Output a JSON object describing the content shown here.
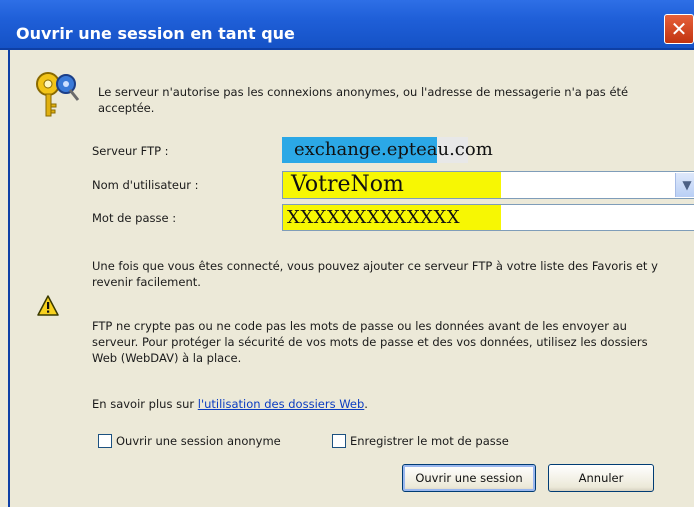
{
  "window": {
    "title": "Ouvrir une session en tant que",
    "close_glyph": "✕"
  },
  "message": "Le serveur n'autorise pas les connexions anonymes, ou l'adresse de messagerie n'a pas été acceptée.",
  "fields": {
    "server_label": "Serveur FTP :",
    "server_value": "exchange.epteau.com",
    "username_label": "Nom d'utilisateur :",
    "username_value": "VotreNom",
    "password_label": "Mot de passe :",
    "password_value": "XXXXXXXXXXXXX"
  },
  "info": "Une fois que vous êtes connecté, vous pouvez ajouter ce serveur FTP à votre liste des Favoris et y revenir facilement.",
  "warning": "FTP ne crypte pas ou ne code pas les mots de passe ou les données avant de les envoyer au serveur. Pour protéger la sécurité de vos mots de passe et des vos données, utilisez les dossiers Web (WebDAV) à la place.",
  "learn_more": {
    "prefix": "En savoir plus sur",
    "link": "l'utilisation des dossiers Web",
    "suffix": "."
  },
  "options": {
    "anonymous_label": "Ouvrir une session anonyme",
    "anonymous_checked": false,
    "save_password_label": "Enregistrer le mot de passe",
    "save_password_checked": false
  },
  "buttons": {
    "login": "Ouvrir une session",
    "cancel": "Annuler"
  },
  "icons": {
    "keys": "keys-icon",
    "warning": "warning-icon",
    "dropdown": "chevron-down-icon"
  },
  "colors": {
    "titlebar": "#1f5fd8",
    "highlight_yellow": "#f7f703",
    "highlight_blue": "#2ba8e6",
    "link": "#0b3cc1"
  }
}
